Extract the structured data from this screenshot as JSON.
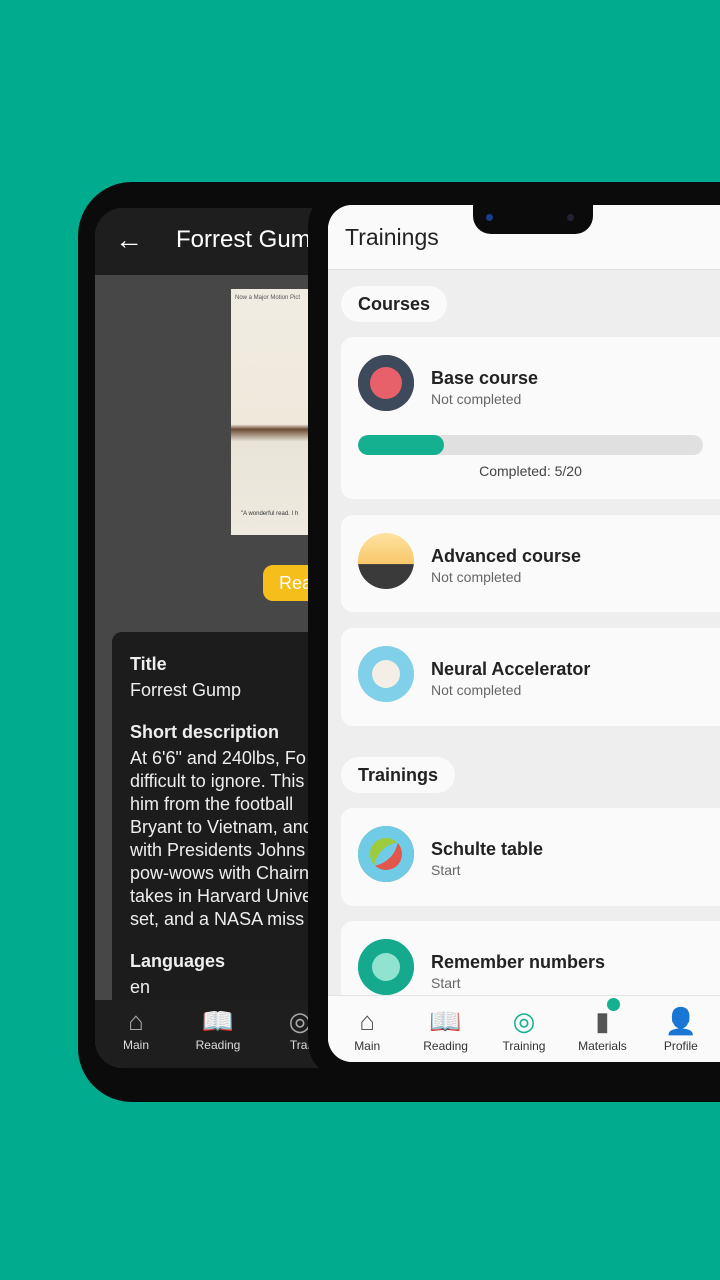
{
  "back_screen": {
    "title": "Forrest Gump",
    "cover_top_text": "Now a Major Motion Pict",
    "cover_quote": "\"A wonderful read. I h",
    "read_button": "Rea",
    "title_label": "Title",
    "title_value": "Forrest Gump",
    "desc_label": "Short description",
    "desc_lines": [
      "At 6'6\" and 240lbs, Fo",
      "difficult to ignore. This",
      "him from the football",
      "Bryant to Vietnam, and",
      "with Presidents Johns",
      "pow-wows with Chairn",
      "takes in Harvard Unive",
      "set, and a NASA miss"
    ],
    "lang_label": "Languages",
    "lang_value": "en",
    "nav": [
      {
        "label": "Main",
        "icon": "home-icon"
      },
      {
        "label": "Reading",
        "icon": "reading-icon",
        "active": true
      },
      {
        "label": "Trai",
        "icon": "target-icon"
      }
    ],
    "active_color": "#f6be1a"
  },
  "front_screen": {
    "title": "Trainings",
    "courses_label": "Courses",
    "courses": [
      {
        "name": "Base course",
        "status": "Not completed",
        "progress": 0.25,
        "completed_text": "Completed: 5/20",
        "icon": "brain-icon"
      },
      {
        "name": "Advanced course",
        "status": "Not completed",
        "icon": "road-icon"
      },
      {
        "name": "Neural Accelerator",
        "status": "Not completed",
        "icon": "lightbulb-brain-icon"
      }
    ],
    "trainings_label": "Trainings",
    "trainings": [
      {
        "name": "Schulte table",
        "status": "Start",
        "icon": "number-grid-icon"
      },
      {
        "name": "Remember numbers",
        "status": "Start",
        "icon": "calculator-icon"
      }
    ],
    "nav": [
      {
        "label": "Main",
        "icon": "home-icon"
      },
      {
        "label": "Reading",
        "icon": "reading-icon"
      },
      {
        "label": "Training",
        "icon": "target-icon",
        "active": true
      },
      {
        "label": "Materials",
        "icon": "book-icon",
        "badge": true
      },
      {
        "label": "Profile",
        "icon": "person-icon"
      }
    ],
    "accent_color": "#14b08f"
  },
  "background_color": "#00ab8e"
}
